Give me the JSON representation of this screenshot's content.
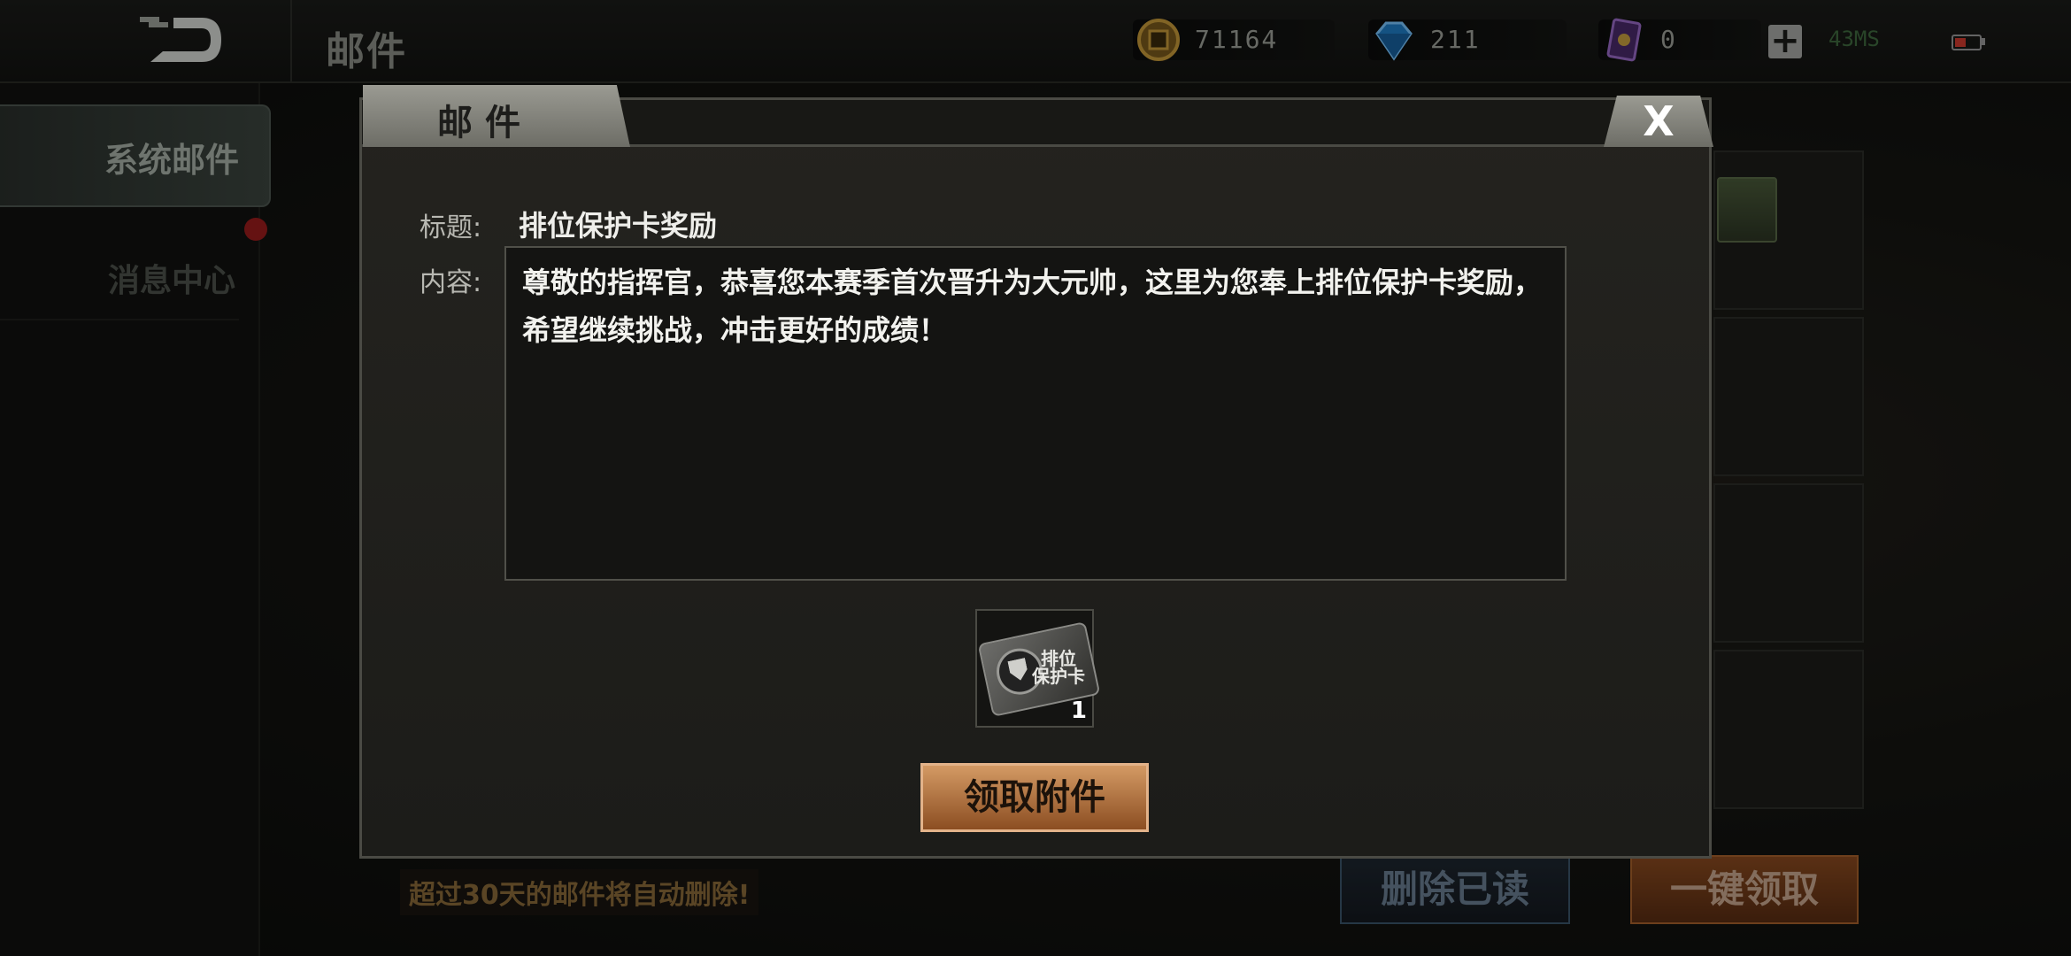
{
  "header": {
    "title": "邮件",
    "gold": "71164",
    "gems": "211",
    "cards": "0",
    "ping": "43MS"
  },
  "sidebar": {
    "items": [
      {
        "label": "系统邮件"
      },
      {
        "label": "消息中心"
      }
    ]
  },
  "modal": {
    "tab_label": "邮件",
    "close_label": "X",
    "title_label": "标题:",
    "title_value": "排位保护卡奖励",
    "content_label": "内容:",
    "content_value": "尊敬的指挥官，恭喜您本赛季首次晋升为大元帅，这里为您奉上排位保护卡奖励，希望继续挑战，冲击更好的成绩！",
    "attachment": {
      "name": "排位保护卡",
      "count": "1"
    },
    "claim_label": "领取附件"
  },
  "footer": {
    "notice": "超过30天的邮件将自动删除!",
    "delete_read_label": "删除已读",
    "claim_all_label": "一键领取"
  },
  "colors": {
    "accent_orange": "#a8622c",
    "ping_green": "#3f6b3f",
    "unread_red": "#9c1c1c"
  }
}
